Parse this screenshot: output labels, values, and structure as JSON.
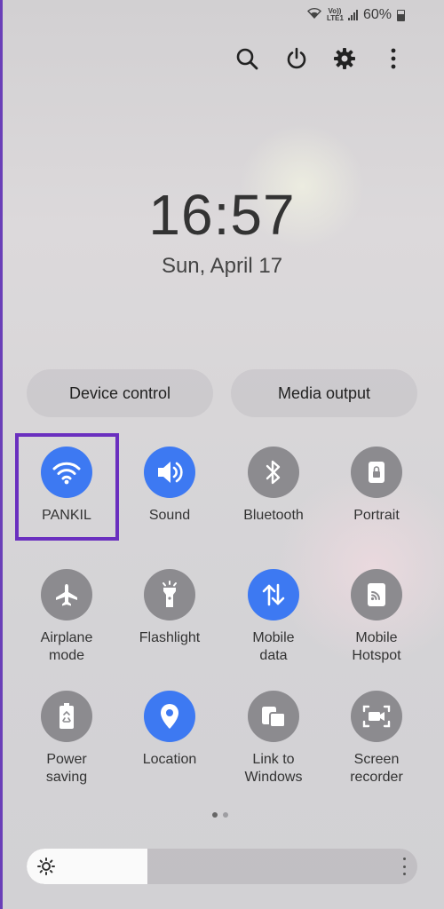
{
  "status_bar": {
    "volte": "Vo)) LTE1",
    "battery_percent": "60%"
  },
  "clock": {
    "time": "16:57",
    "date": "Sun, April 17"
  },
  "pills": {
    "device_control": "Device control",
    "media_output": "Media output"
  },
  "tiles": [
    {
      "label": "PANKIL",
      "icon": "wifi-icon",
      "on": true
    },
    {
      "label": "Sound",
      "icon": "sound-icon",
      "on": true
    },
    {
      "label": "Bluetooth",
      "icon": "bluetooth-icon",
      "on": false
    },
    {
      "label": "Portrait",
      "icon": "lock-icon",
      "on": false
    },
    {
      "label": "Airplane mode",
      "icon": "airplane-icon",
      "on": false
    },
    {
      "label": "Flashlight",
      "icon": "flashlight-icon",
      "on": false
    },
    {
      "label": "Mobile data",
      "icon": "mobile-data-icon",
      "on": true
    },
    {
      "label": "Mobile Hotspot",
      "icon": "hotspot-icon",
      "on": false
    },
    {
      "label": "Power saving",
      "icon": "power-saving-icon",
      "on": false
    },
    {
      "label": "Location",
      "icon": "location-icon",
      "on": true
    },
    {
      "label": "Link to Windows",
      "icon": "link-windows-icon",
      "on": false
    },
    {
      "label": "Screen recorder",
      "icon": "screen-recorder-icon",
      "on": false
    }
  ],
  "page_indicator": {
    "current": 1,
    "total": 2
  },
  "brightness": {
    "level": 0.31
  },
  "colors": {
    "active": "#3d79f2",
    "inactive": "#8c8b8f",
    "highlight": "#6a2fbf"
  }
}
